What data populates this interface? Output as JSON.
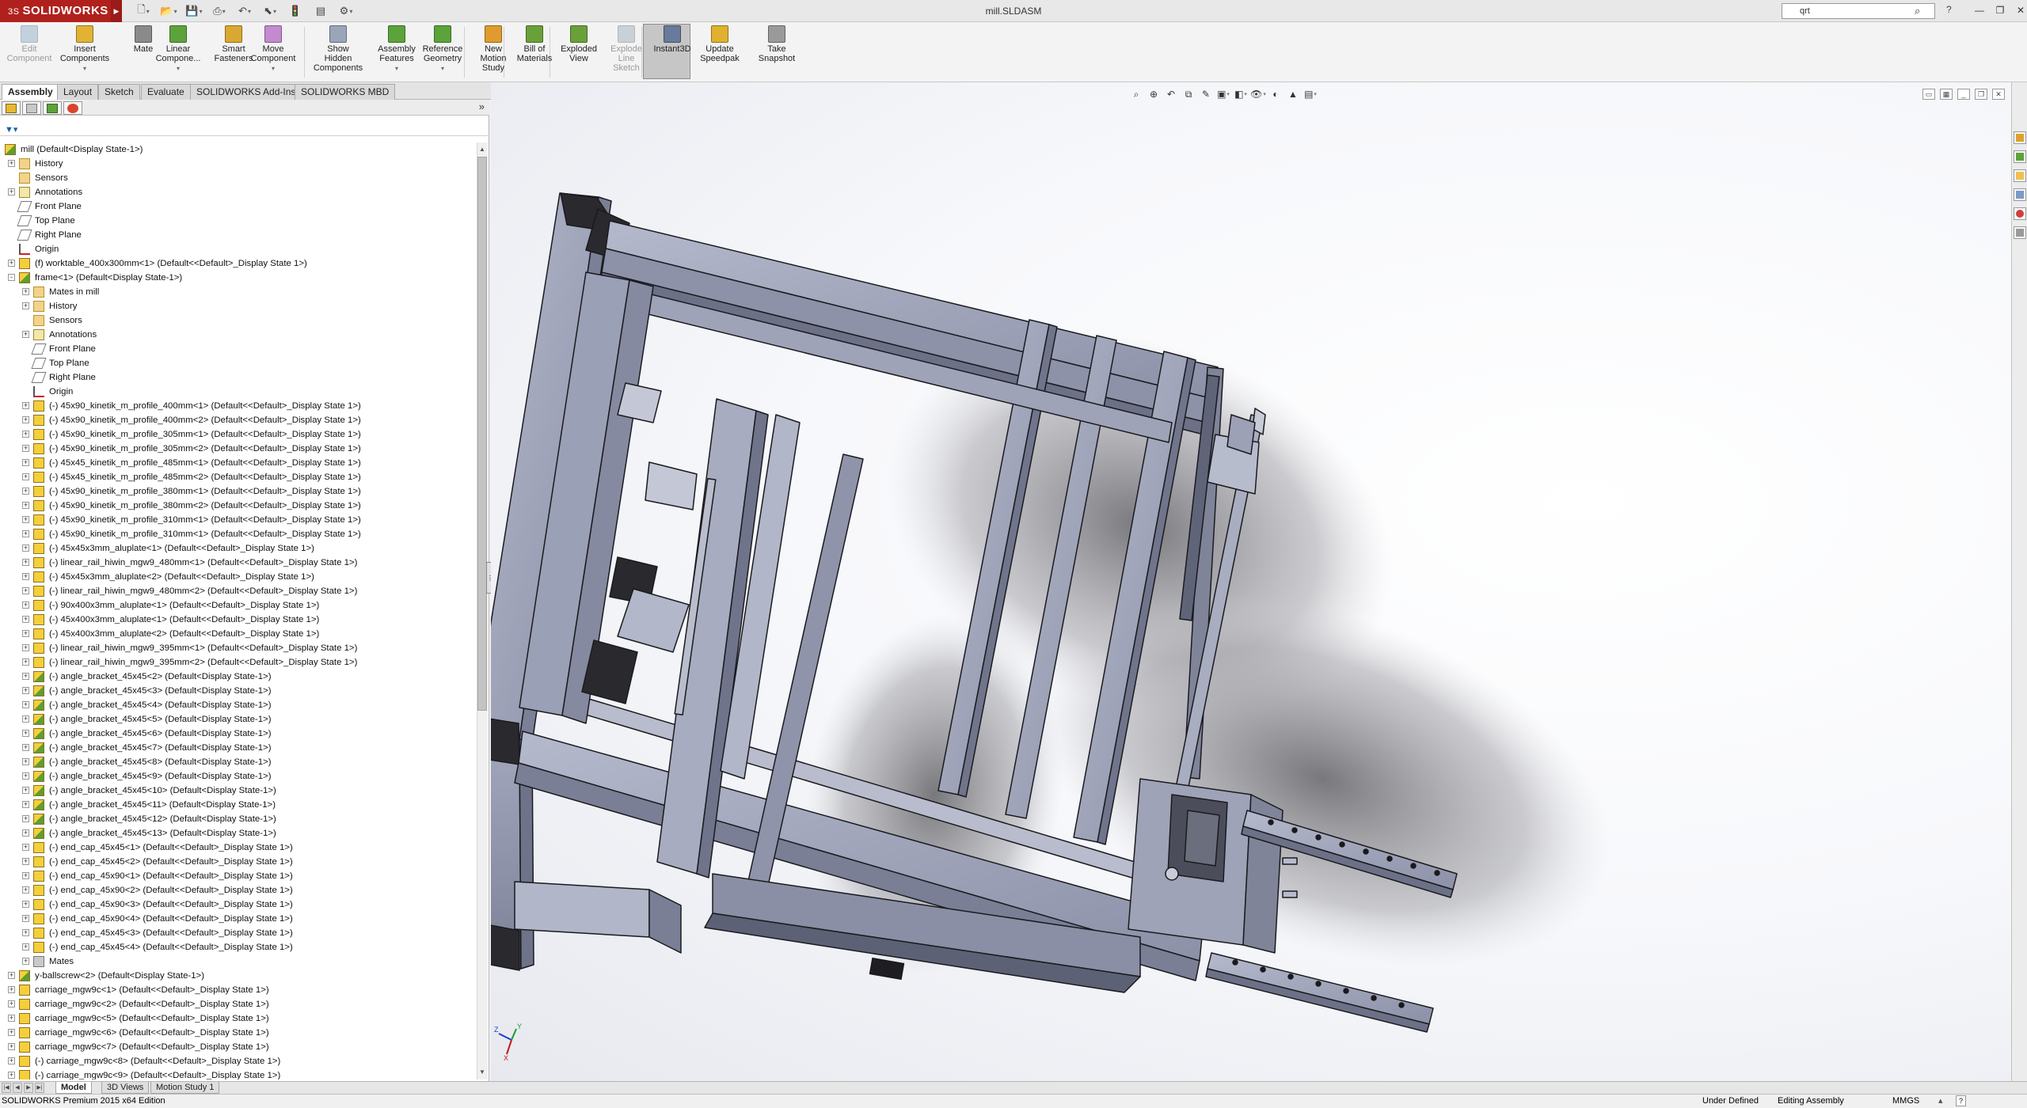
{
  "app": {
    "brand": "SOLIDWORKS",
    "brand_prefix": "3S",
    "document_title": "mill.SLDASM",
    "search_value": "qrt",
    "status_left": "SOLIDWORKS Premium 2015 x64 Edition",
    "status_items": [
      "Under Defined",
      "Editing Assembly",
      "MMGS"
    ]
  },
  "ribbon": {
    "buttons": [
      {
        "label": "Edit\nComponent",
        "disabled": true,
        "color": "#8aa8c8"
      },
      {
        "label": "Insert\nComponents",
        "disabled": false,
        "color": "#e2b234"
      },
      {
        "label": "Mate",
        "disabled": false,
        "color": "#8a8a8a"
      },
      {
        "label": "Linear\nCompone...",
        "disabled": false,
        "color": "#5ba33a"
      },
      {
        "label": "Smart\nFasteners",
        "disabled": false,
        "color": "#d9a831"
      },
      {
        "label": "Move\nComponent",
        "disabled": false,
        "color": "#c48ad0"
      },
      {
        "label": "Show\nHidden\nComponents",
        "disabled": false,
        "color": "#9aa6b8"
      },
      {
        "label": "Assembly\nFeatures",
        "disabled": false,
        "color": "#5ba33a"
      },
      {
        "label": "Reference\nGeometry",
        "disabled": false,
        "color": "#5ba33a"
      },
      {
        "label": "New\nMotion\nStudy",
        "disabled": false,
        "color": "#e09b2e"
      },
      {
        "label": "Bill of\nMaterials",
        "disabled": false,
        "color": "#6aa03a"
      },
      {
        "label": "Exploded\nView",
        "disabled": false,
        "color": "#6aa03a"
      },
      {
        "label": "Explode\nLine\nSketch",
        "disabled": true,
        "color": "#9aa6b8"
      },
      {
        "label": "Instant3D",
        "disabled": false,
        "color": "#6a7a9a"
      },
      {
        "label": "Update\nSpeedpak",
        "disabled": false,
        "color": "#e0b030"
      },
      {
        "label": "Take\nSnapshot",
        "disabled": false,
        "color": "#9a9a9a"
      }
    ]
  },
  "command_tabs": [
    "Assembly",
    "Layout",
    "Sketch",
    "Evaluate",
    "SOLIDWORKS Add-Ins",
    "SOLIDWORKS MBD"
  ],
  "tree": [
    {
      "label": "mill  (Default<Display State-1>)",
      "level": 0,
      "icon": "asm",
      "exp": ""
    },
    {
      "label": "History",
      "level": 1,
      "icon": "folder",
      "exp": "+"
    },
    {
      "label": "Sensors",
      "level": 1,
      "icon": "folder",
      "exp": ""
    },
    {
      "label": "Annotations",
      "level": 1,
      "icon": "annot",
      "exp": "+"
    },
    {
      "label": "Front Plane",
      "level": 1,
      "icon": "plane",
      "exp": ""
    },
    {
      "label": "Top Plane",
      "level": 1,
      "icon": "plane",
      "exp": ""
    },
    {
      "label": "Right Plane",
      "level": 1,
      "icon": "plane",
      "exp": ""
    },
    {
      "label": "Origin",
      "level": 1,
      "icon": "origin",
      "exp": ""
    },
    {
      "label": "(f) worktable_400x300mm<1> (Default<<Default>_Display State 1>)",
      "level": 1,
      "icon": "part",
      "exp": "+"
    },
    {
      "label": "frame<1> (Default<Display State-1>)",
      "level": 1,
      "icon": "asm",
      "exp": "-"
    },
    {
      "label": "Mates in mill",
      "level": 2,
      "icon": "folder",
      "exp": "+"
    },
    {
      "label": "History",
      "level": 2,
      "icon": "folder",
      "exp": "+"
    },
    {
      "label": "Sensors",
      "level": 2,
      "icon": "folder",
      "exp": ""
    },
    {
      "label": "Annotations",
      "level": 2,
      "icon": "annot",
      "exp": "+"
    },
    {
      "label": "Front Plane",
      "level": 2,
      "icon": "plane",
      "exp": ""
    },
    {
      "label": "Top Plane",
      "level": 2,
      "icon": "plane",
      "exp": ""
    },
    {
      "label": "Right Plane",
      "level": 2,
      "icon": "plane",
      "exp": ""
    },
    {
      "label": "Origin",
      "level": 2,
      "icon": "origin",
      "exp": ""
    },
    {
      "label": "(-) 45x90_kinetik_m_profile_400mm<1> (Default<<Default>_Display State 1>)",
      "level": 2,
      "icon": "part",
      "exp": "+"
    },
    {
      "label": "(-) 45x90_kinetik_m_profile_400mm<2> (Default<<Default>_Display State 1>)",
      "level": 2,
      "icon": "part",
      "exp": "+"
    },
    {
      "label": "(-) 45x90_kinetik_m_profile_305mm<1> (Default<<Default>_Display State 1>)",
      "level": 2,
      "icon": "part",
      "exp": "+"
    },
    {
      "label": "(-) 45x90_kinetik_m_profile_305mm<2> (Default<<Default>_Display State 1>)",
      "level": 2,
      "icon": "part",
      "exp": "+"
    },
    {
      "label": "(-) 45x45_kinetik_m_profile_485mm<1> (Default<<Default>_Display State 1>)",
      "level": 2,
      "icon": "part",
      "exp": "+"
    },
    {
      "label": "(-) 45x45_kinetik_m_profile_485mm<2> (Default<<Default>_Display State 1>)",
      "level": 2,
      "icon": "part",
      "exp": "+"
    },
    {
      "label": "(-) 45x90_kinetik_m_profile_380mm<1> (Default<<Default>_Display State 1>)",
      "level": 2,
      "icon": "part",
      "exp": "+"
    },
    {
      "label": "(-) 45x90_kinetik_m_profile_380mm<2> (Default<<Default>_Display State 1>)",
      "level": 2,
      "icon": "part",
      "exp": "+"
    },
    {
      "label": "(-) 45x90_kinetik_m_profile_310mm<1> (Default<<Default>_Display State 1>)",
      "level": 2,
      "icon": "part",
      "exp": "+"
    },
    {
      "label": "(-) 45x90_kinetik_m_profile_310mm<1> (Default<<Default>_Display State 1>)",
      "level": 2,
      "icon": "part",
      "exp": "+"
    },
    {
      "label": "(-) 45x45x3mm_aluplate<1> (Default<<Default>_Display State 1>)",
      "level": 2,
      "icon": "part",
      "exp": "+"
    },
    {
      "label": "(-) linear_rail_hiwin_mgw9_480mm<1> (Default<<Default>_Display State 1>)",
      "level": 2,
      "icon": "part",
      "exp": "+"
    },
    {
      "label": "(-) 45x45x3mm_aluplate<2> (Default<<Default>_Display State 1>)",
      "level": 2,
      "icon": "part",
      "exp": "+"
    },
    {
      "label": "(-) linear_rail_hiwin_mgw9_480mm<2> (Default<<Default>_Display State 1>)",
      "level": 2,
      "icon": "part",
      "exp": "+"
    },
    {
      "label": "(-) 90x400x3mm_aluplate<1> (Default<<Default>_Display State 1>)",
      "level": 2,
      "icon": "part",
      "exp": "+"
    },
    {
      "label": "(-) 45x400x3mm_aluplate<1> (Default<<Default>_Display State 1>)",
      "level": 2,
      "icon": "part",
      "exp": "+"
    },
    {
      "label": "(-) 45x400x3mm_aluplate<2> (Default<<Default>_Display State 1>)",
      "level": 2,
      "icon": "part",
      "exp": "+"
    },
    {
      "label": "(-) linear_rail_hiwin_mgw9_395mm<1> (Default<<Default>_Display State 1>)",
      "level": 2,
      "icon": "part",
      "exp": "+"
    },
    {
      "label": "(-) linear_rail_hiwin_mgw9_395mm<2> (Default<<Default>_Display State 1>)",
      "level": 2,
      "icon": "part",
      "exp": "+"
    },
    {
      "label": "(-) angle_bracket_45x45<2> (Default<Display State-1>)",
      "level": 2,
      "icon": "asm",
      "exp": "+"
    },
    {
      "label": "(-) angle_bracket_45x45<3> (Default<Display State-1>)",
      "level": 2,
      "icon": "asm",
      "exp": "+"
    },
    {
      "label": "(-) angle_bracket_45x45<4> (Default<Display State-1>)",
      "level": 2,
      "icon": "asm",
      "exp": "+"
    },
    {
      "label": "(-) angle_bracket_45x45<5> (Default<Display State-1>)",
      "level": 2,
      "icon": "asm",
      "exp": "+"
    },
    {
      "label": "(-) angle_bracket_45x45<6> (Default<Display State-1>)",
      "level": 2,
      "icon": "asm",
      "exp": "+"
    },
    {
      "label": "(-) angle_bracket_45x45<7> (Default<Display State-1>)",
      "level": 2,
      "icon": "asm",
      "exp": "+"
    },
    {
      "label": "(-) angle_bracket_45x45<8> (Default<Display State-1>)",
      "level": 2,
      "icon": "asm",
      "exp": "+"
    },
    {
      "label": "(-) angle_bracket_45x45<9> (Default<Display State-1>)",
      "level": 2,
      "icon": "asm",
      "exp": "+"
    },
    {
      "label": "(-) angle_bracket_45x45<10> (Default<Display State-1>)",
      "level": 2,
      "icon": "asm",
      "exp": "+"
    },
    {
      "label": "(-) angle_bracket_45x45<11> (Default<Display State-1>)",
      "level": 2,
      "icon": "asm",
      "exp": "+"
    },
    {
      "label": "(-) angle_bracket_45x45<12> (Default<Display State-1>)",
      "level": 2,
      "icon": "asm",
      "exp": "+"
    },
    {
      "label": "(-) angle_bracket_45x45<13> (Default<Display State-1>)",
      "level": 2,
      "icon": "asm",
      "exp": "+"
    },
    {
      "label": "(-) end_cap_45x45<1> (Default<<Default>_Display State 1>)",
      "level": 2,
      "icon": "part",
      "exp": "+"
    },
    {
      "label": "(-) end_cap_45x45<2> (Default<<Default>_Display State 1>)",
      "level": 2,
      "icon": "part",
      "exp": "+"
    },
    {
      "label": "(-) end_cap_45x90<1> (Default<<Default>_Display State 1>)",
      "level": 2,
      "icon": "part",
      "exp": "+"
    },
    {
      "label": "(-) end_cap_45x90<2> (Default<<Default>_Display State 1>)",
      "level": 2,
      "icon": "part",
      "exp": "+"
    },
    {
      "label": "(-) end_cap_45x90<3> (Default<<Default>_Display State 1>)",
      "level": 2,
      "icon": "part",
      "exp": "+"
    },
    {
      "label": "(-) end_cap_45x90<4> (Default<<Default>_Display State 1>)",
      "level": 2,
      "icon": "part",
      "exp": "+"
    },
    {
      "label": "(-) end_cap_45x45<3> (Default<<Default>_Display State 1>)",
      "level": 2,
      "icon": "part",
      "exp": "+"
    },
    {
      "label": "(-) end_cap_45x45<4> (Default<<Default>_Display State 1>)",
      "level": 2,
      "icon": "part",
      "exp": "+"
    },
    {
      "label": "Mates",
      "level": 2,
      "icon": "mates",
      "exp": "+"
    },
    {
      "label": "y-ballscrew<2> (Default<Display State-1>)",
      "level": 1,
      "icon": "asm",
      "exp": "+"
    },
    {
      "label": "carriage_mgw9c<1> (Default<<Default>_Display State 1>)",
      "level": 1,
      "icon": "part",
      "exp": "+"
    },
    {
      "label": "carriage_mgw9c<2> (Default<<Default>_Display State 1>)",
      "level": 1,
      "icon": "part",
      "exp": "+"
    },
    {
      "label": "carriage_mgw9c<5> (Default<<Default>_Display State 1>)",
      "level": 1,
      "icon": "part",
      "exp": "+"
    },
    {
      "label": "carriage_mgw9c<6> (Default<<Default>_Display State 1>)",
      "level": 1,
      "icon": "part",
      "exp": "+"
    },
    {
      "label": "carriage_mgw9c<7> (Default<<Default>_Display State 1>)",
      "level": 1,
      "icon": "part",
      "exp": "+"
    },
    {
      "label": "(-) carriage_mgw9c<8> (Default<<Default>_Display State 1>)",
      "level": 1,
      "icon": "part",
      "exp": "+"
    },
    {
      "label": "(-) carriage_mgw9c<9> (Default<<Default>_Display State 1>)",
      "level": 1,
      "icon": "part",
      "exp": "+"
    }
  ],
  "bottom_tabs": [
    "Model",
    "3D Views",
    "Motion Study 1"
  ],
  "triad": {
    "x_label": "X",
    "y_label": "Y",
    "z_label": "Z"
  },
  "icons": {
    "hud": [
      "zoom-to-fit-icon",
      "zoom-to-area-icon",
      "previous-view-icon",
      "section-view-icon",
      "dynamic-annotation-view-icon",
      "view-orientation-icon",
      "display-style-icon",
      "hide-show-items-icon",
      "edit-appearance-icon",
      "apply-scene-icon",
      "view-settings-icon"
    ],
    "colors": {
      "brand": "#b0211e",
      "model_face": "#9ba1b8",
      "model_dark": "#2a2a2e",
      "viewport_bg": "#f5f6f9"
    }
  }
}
